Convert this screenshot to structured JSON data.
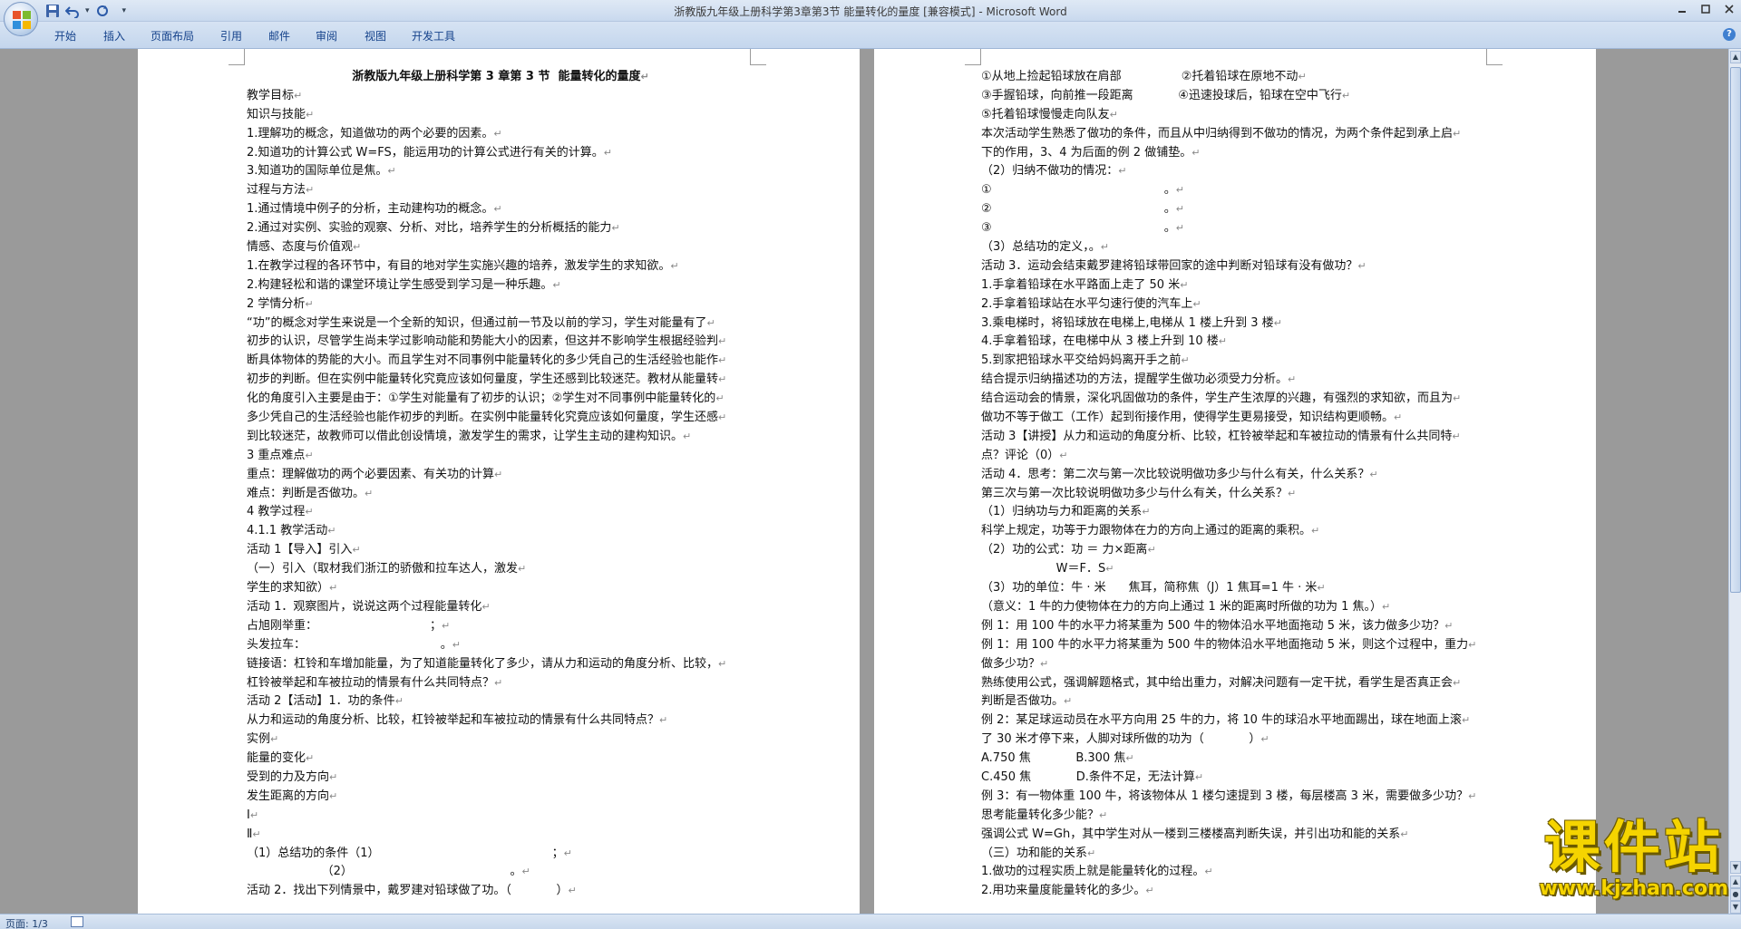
{
  "window": {
    "title": "浙教版九年级上册科学第3章第3节 能量转化的量度 [兼容模式] - Microsoft Word"
  },
  "qat": {
    "dropdown_glyph": "▾"
  },
  "ribbon": {
    "tabs": [
      "开始",
      "插入",
      "页面布局",
      "引用",
      "邮件",
      "审阅",
      "视图",
      "开发工具"
    ],
    "help_label": "?"
  },
  "colors": {
    "accent": "#15428b",
    "watermark": "#f5d400"
  },
  "left_page": {
    "lines": [
      "浙教版九年级上册科学第 3 章第 3 节  能量转化的量度",
      "教学目标",
      "知识与技能",
      "1.理解功的概念，知道做功的两个必要的因素。",
      "2.知道功的计算公式 W=FS，能运用功的计算公式进行有关的计算。",
      "3.知道功的国际单位是焦。",
      "过程与方法",
      "1.通过情境中例子的分析，主动建构功的概念。",
      "2.通过对实例、实验的观察、分析、对比，培养学生的分析概括的能力",
      "情感、态度与价值观",
      "1.在教学过程的各环节中，有目的地对学生实施兴趣的培养，激发学生的求知欲。",
      "2.构建轻松和谐的课堂环境让学生感受到学习是一种乐趣。",
      "2 学情分析",
      "“功”的概念对学生来说是一个全新的知识，但通过前一节及以前的学习，学生对能量有了",
      "初步的认识，尽管学生尚未学过影响动能和势能大小的因素，但这并不影响学生根据经验判",
      "断具体物体的势能的大小。而且学生对不同事例中能量转化的多少凭自己的生活经验也能作",
      "初步的判断。但在实例中能量转化究竟应该如何量度，学生还感到比较迷茫。教材从能量转",
      "化的角度引入主要是由于：①学生对能量有了初步的认识；②学生对不同事例中能量转化的",
      "多少凭自己的生活经验也能作初步的判断。在实例中能量转化究竟应该如何量度，学生还感",
      "到比较迷茫，故教师可以借此创设情境，激发学生的需求，让学生主动的建构知识。",
      "3 重点难点",
      "重点：理解做功的两个必要因素、有关功的计算",
      "难点：判断是否做功。",
      "4 教学过程",
      "4.1.1 教学活动",
      "活动 1【导入】引入",
      "（一）引入（取材我们浙江的骄傲和拉车达人，激发",
      "学生的求知欲）",
      "活动 1．观察图片，说说这两个过程能量转化",
      "占旭刚举重：                              ；",
      "头发拉车：                                    。",
      "链接语：杠铃和车增加能量，为了知道能量转化了多少，请从力和运动的角度分析、比较，",
      "杠铃被举起和车被拉动的情景有什么共同特点？",
      "活动 2【活动】1．功的条件",
      "从力和运动的角度分析、比较，杠铃被举起和车被拉动的情景有什么共同特点？",
      "实例",
      "能量的变化",
      "受到的力及方向",
      "发生距离的方向",
      "Ⅰ",
      "Ⅱ",
      "（1）总结功的条件（1）                                              ；",
      "                    （2）                                          。",
      "活动 2．找出下列情景中，戴罗建对铅球做了功。（            ）"
    ]
  },
  "right_page": {
    "lines": [
      "①从地上捡起铅球放在肩部                ②托着铅球在原地不动",
      "③手握铅球，向前推一段距离            ④迅速投球后，铅球在空中飞行",
      "⑤托着铅球慢慢走向队友",
      "本次活动学生熟悉了做功的条件，而且从中归纳得到不做功的情况，为两个条件起到承上启",
      "下的作用，3、4 为后面的例 2 做铺垫。",
      "（2）归纳不做功的情况：",
      "①                                              。",
      "②                                              。",
      "③                                              。",
      "（3）总结功的定义，。",
      "活动 3．运动会结束戴罗建将铅球带回家的途中判断对铅球有没有做功？",
      "1.手拿着铅球在水平路面上走了 50 米",
      "2.手拿着铅球站在水平匀速行使的汽车上",
      "3.乘电梯时，将铅球放在电梯上,电梯从 1 楼上升到 3 楼",
      "4.手拿着铅球，在电梯中从 3 楼上升到 10 楼",
      "5.到家把铅球水平交给妈妈离开手之前",
      "结合提示归纳描述功的方法，提醒学生做功必须受力分析。",
      "结合运动会的情景，深化巩固做功的条件，学生产生浓厚的兴趣，有强烈的求知欲，而且为",
      "做功不等于做工（工作）起到衔接作用，使得学生更易接受，知识结构更顺畅。",
      "活动 3【讲授】从力和运动的角度分析、比较，杠铃被举起和车被拉动的情景有什么共同特",
      "点？评论（0）",
      "活动 4．思考：第二次与第一次比较说明做功多少与什么有关，什么关系？",
      "第三次与第一次比较说明做功多少与什么有关，什么关系？",
      "（1）归纳功与力和距离的关系",
      "科学上规定，功等于力跟物体在力的方向上通过的距离的乘积。",
      "（2）功的公式：功 ＝ 力×距离",
      "                    W＝F．S",
      "（3）功的单位：牛 · 米      焦耳，简称焦（J）1 焦耳=1 牛 · 米",
      "（意义：1 牛的力使物体在力的方向上通过 1 米的距离时所做的功为 1 焦。）",
      "例 1：用 100 牛的水平力将某重为 500 牛的物体沿水平地面拖动 5 米，该力做多少功？",
      "例 1：用 100 牛的水平力将某重为 500 牛的物体沿水平地面拖动 5 米，则这个过程中，重力",
      "做多少功？",
      "熟练使用公式，强调解题格式，其中给出重力，对解决问题有一定干扰，看学生是否真正会",
      "判断是否做功。",
      "例 2：某足球运动员在水平方向用 25 牛的力，将 10 牛的球沿水平地面踢出，球在地面上滚",
      "了 30 米才停下来，人脚对球所做的功为（            ）",
      "A.750 焦            B.300 焦",
      "C.450 焦            D.条件不足，无法计算",
      "例 3：有一物体重 100 牛，将该物体从 1 楼匀速提到 3 楼，每层楼高 3 米，需要做多少功？",
      "思考能量转化多少能？",
      "强调公式 W=Gh，其中学生对从一楼到三楼楼高判断失误，并引出功和能的关系",
      "（三）功和能的关系",
      "1.做功的过程实质上就是能量转化的过程。",
      "2.用功来量度能量转化的多少。"
    ]
  },
  "paragraph_mark": "↵",
  "status": {
    "page_indicator": "页面: 1/3"
  },
  "watermark": {
    "text": "课件站",
    "url": "www.kjzhan.com"
  }
}
